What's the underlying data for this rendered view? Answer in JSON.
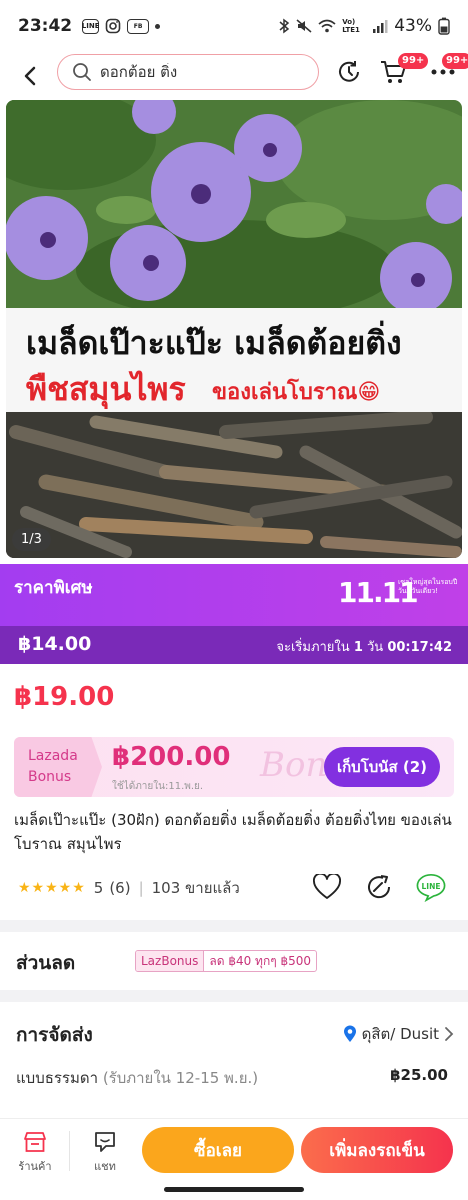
{
  "status": {
    "time": "23:42",
    "app_badges": [
      "LINE",
      "IG",
      "FB"
    ],
    "network": "Vo) LTE1",
    "battery": "43%"
  },
  "header": {
    "search_value": "ดอกต้อย ติ่ง",
    "cart_badge": "99+",
    "more_badge": "99+"
  },
  "gallery": {
    "caption_line1": "เมล็ดเป๊าะแป๊ะ  เมล็ดต้อยติ่ง",
    "caption_line2": "พืชสมุนไพร",
    "caption_line3": "ของเล่นโบราณ😁",
    "counter": "1/3"
  },
  "promo": {
    "label": "ราคาพิเศษ",
    "logo": "11.11",
    "logo_tagline": "เซลใหญ่สุดในรอบปี วันนี้วันเดียว!",
    "special_price": "฿14.00",
    "countdown_prefix": "จะเริ่มภายใน",
    "countdown_days": "1",
    "countdown_unit": "วัน",
    "countdown_time": "00:17:42"
  },
  "price": {
    "regular": "฿19.00"
  },
  "bonus": {
    "brand_line1": "Lazada",
    "brand_line2": "Bonus",
    "amount": "฿200.00",
    "valid_until": "ใช้ได้ภายใน:11.พ.ย.",
    "watermark": "Bonus",
    "collect_label": "เก็บโบนัส (2)"
  },
  "product": {
    "title": "เมล็ดเป๊าะแป๊ะ (30ฝัก) ดอกต้อยติ่ง เมล็ดต้อยติ่ง ต้อยติ่งไทย ของเล่นโบราณ สมุนไพร",
    "rating_stars": "★★★★★",
    "rating_score": "5",
    "rating_count": "(6)",
    "sold": "103 ขายแล้ว",
    "line_label": "LINE"
  },
  "discount": {
    "title": "ส่วนลด",
    "voucher_tag": "LazBonus",
    "voucher_text": "ลด ฿40 ทุกๆ ฿500"
  },
  "shipping": {
    "title": "การจัดส่ง",
    "location": "ดุสิต/ Dusit",
    "method": "แบบธรรมดา",
    "eta": "(รับภายใน 12-15 พ.ย.)",
    "fee": "฿25.00"
  },
  "bottom": {
    "store_label": "ร้านค้า",
    "chat_label": "แชท",
    "buy_now": "ซื้อเลย",
    "add_to_cart": "เพิ่มลงรถเข็น"
  },
  "colors": {
    "accent_red": "#f5334d",
    "promo_purple": "#a33df0",
    "price_band": "#7a2ab8",
    "buy_orange": "#fba61c",
    "bonus_pink": "#e02f7a"
  }
}
